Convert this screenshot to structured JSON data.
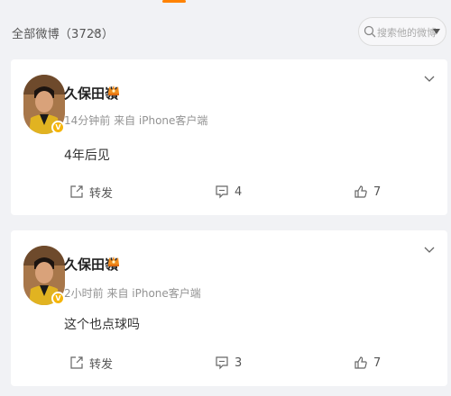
{
  "filter": {
    "label": "全部微博（3728）"
  },
  "search": {
    "placeholder": "搜索他的微博"
  },
  "posts": [
    {
      "username": "久保田嶺",
      "meta": "14分钟前 来自 iPhone客户端",
      "text": "4年后见",
      "forward_label": "转发",
      "comment_count": "4",
      "like_count": "7"
    },
    {
      "username": "久保田嶺",
      "meta": "2小时前 来自 iPhone客户端",
      "text": "这个也点球吗",
      "forward_label": "转发",
      "comment_count": "3",
      "like_count": "7"
    }
  ],
  "colors": {
    "accent": "#ff8200",
    "badge": "#f5b50a",
    "background": "#f1f2f5"
  }
}
